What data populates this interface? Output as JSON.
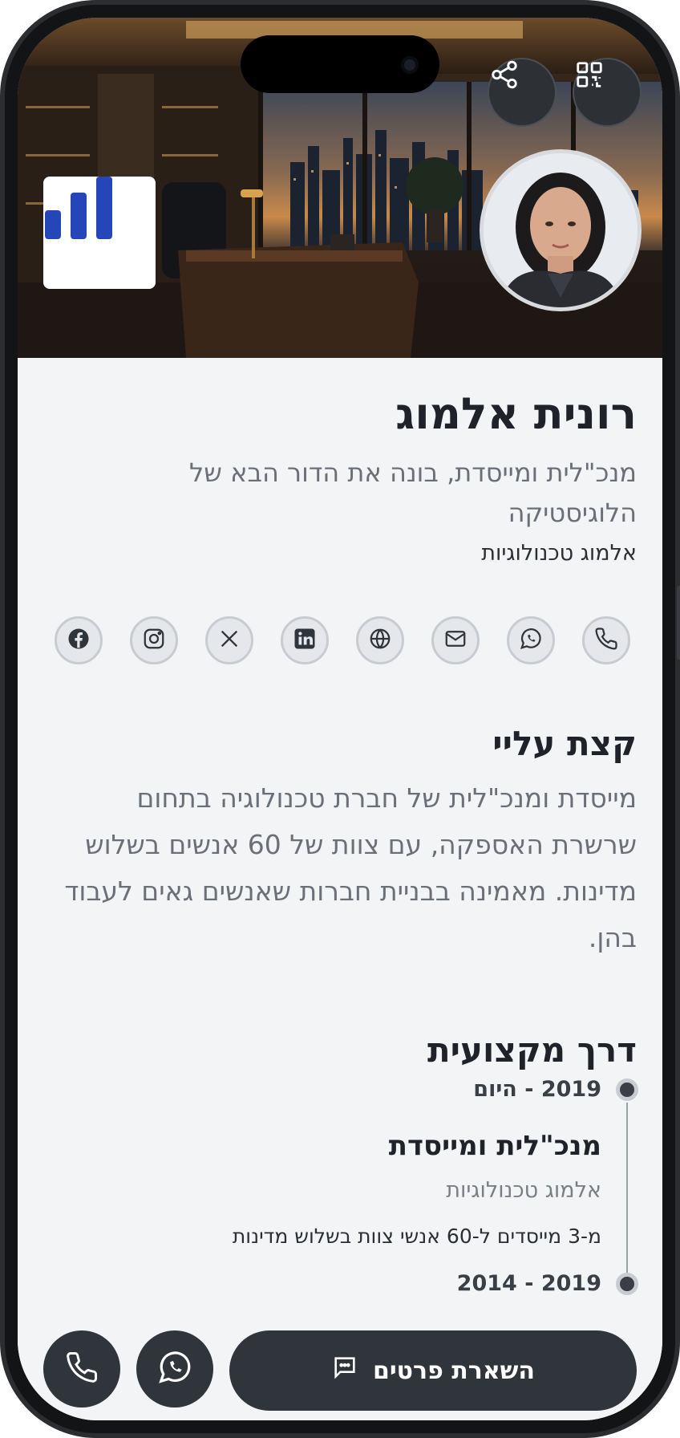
{
  "profile": {
    "name": "רונית אלמוג",
    "tagline": "מנכ\"לית ומייסדת, בונה את הדור הבא של הלוגיסטיקה",
    "company": "אלמוג טכנולוגיות"
  },
  "header": {
    "share_icon": "share-icon",
    "qr_icon": "qr-code-icon",
    "logo_icon": "bar-chart-logo"
  },
  "socials": [
    {
      "icon": "phone-icon"
    },
    {
      "icon": "whatsapp-icon"
    },
    {
      "icon": "mail-icon"
    },
    {
      "icon": "globe-icon"
    },
    {
      "icon": "linkedin-icon"
    },
    {
      "icon": "x-icon"
    },
    {
      "icon": "instagram-icon"
    },
    {
      "icon": "facebook-icon"
    }
  ],
  "about": {
    "title": "קצת עליי",
    "text": "מייסדת ומנכ\"לית של חברת טכנולוגיה בתחום שרשרת האספקה, עם צוות של 60 אנשים בשלוש מדינות. מאמינה בבניית חברות שאנשים גאים לעבוד בהן."
  },
  "career": {
    "title": "דרך מקצועית",
    "items": [
      {
        "dates": "2019 - היום",
        "role": "מנכ\"לית ומייסדת",
        "company": "אלמוג טכנולוגיות",
        "description": "מ-3 מייסדים ל-60 אנשי צוות בשלוש מדינות"
      },
      {
        "dates": "2019 - 2014"
      }
    ]
  },
  "actions": {
    "cta_label": "השארת פרטים",
    "cta_icon": "message-icon",
    "whatsapp_icon": "whatsapp-icon",
    "call_icon": "phone-icon"
  },
  "colors": {
    "dark": "#30353b",
    "background": "#f3f4f6",
    "logo_blue": "#2546b8"
  }
}
